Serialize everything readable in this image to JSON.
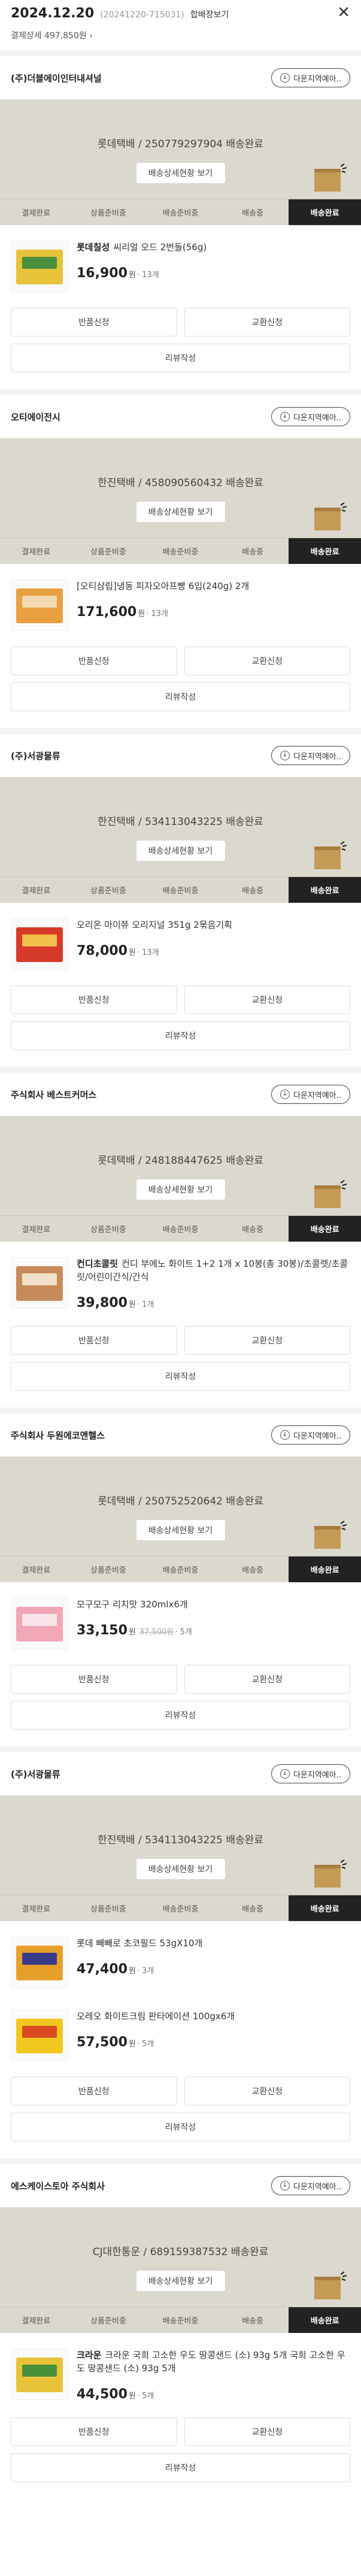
{
  "header": {
    "date": "2024.12.20",
    "order_no": "(20241220-715031)",
    "combine_label": "합배장보기",
    "pay_detail": "결제상세 497,850원 ›",
    "close": "✕"
  },
  "labels": {
    "download": "다운지역예아..",
    "track_button": "배송상세현황 보기",
    "return": "반품신청",
    "exchange": "교환신청",
    "review": "리뷰작성"
  },
  "steps": [
    "결제완료",
    "상품준비중",
    "배송준비중",
    "배송중",
    "배송완료"
  ],
  "sections": [
    {
      "seller": "(주)더블에이인터내셔널",
      "tracking": "롯데택배 / 250779297904 배송완료",
      "items": [
        {
          "brand": "롯데칠성",
          "name": "씨리얼 오드 2번들(56g)",
          "price": "16,900",
          "orig": "",
          "qty": "13개"
        }
      ]
    },
    {
      "seller": "오티에이전시",
      "tracking": "한진택배 / 458090560432 배송완료",
      "items": [
        {
          "brand": "",
          "name": "[오티삼립]냉동 피자오아프빵 6입(240g) 2개",
          "price": "171,600",
          "orig": "",
          "qty": "13개"
        }
      ]
    },
    {
      "seller": "(주)서광물류",
      "tracking": "한진택배 / 534113043225 배송완료",
      "items": [
        {
          "brand": "",
          "name": "오리온 마이쮸 오리지널 351g 2묶음기획",
          "price": "78,000",
          "orig": "",
          "qty": "13개"
        }
      ]
    },
    {
      "seller": "주식회사 베스트커머스",
      "tracking": "롯데택배 / 248188447625 배송완료",
      "items": [
        {
          "brand": "컨디초콜릿",
          "name": "컨디 부에노 화이트 1+2 1개 x 10봉(총 30봉)/초콜렛/초콜릿/어린이간식/간식",
          "price": "39,800",
          "orig": "",
          "qty": "1개"
        }
      ]
    },
    {
      "seller": "주식회사 두원에코앤헬스",
      "tracking": "롯데택배 / 250752520642 배송완료",
      "items": [
        {
          "brand": "",
          "name": "모구모구 리치맛 320mlx6개",
          "price": "33,150",
          "orig": "37,500원",
          "qty": "5개"
        }
      ]
    },
    {
      "seller": "(주)서광물류",
      "tracking": "한진택배 / 534113043225 배송완료",
      "items": [
        {
          "brand": "",
          "name": "롯데 빼빼로 초코필드 53gX10개",
          "price": "47,400",
          "orig": "",
          "qty": "3개"
        },
        {
          "brand": "",
          "name": "오레오 화이트크림 판타에이션 100gx6개",
          "price": "57,500",
          "orig": "",
          "qty": "5개"
        }
      ]
    },
    {
      "seller": "에스케이스토아 주식회사",
      "tracking": "CJ대한통운 / 689159387532 배송완료",
      "items": [
        {
          "brand": "크라운",
          "name": "크라운 국희 고소한 우도 땅콩샌드 (소) 93g 5개 국희 고소한 우도 땅콩샌드 (소) 93g 5개",
          "price": "44,500",
          "orig": "",
          "qty": "5개"
        }
      ]
    }
  ],
  "colors": {
    "delivery_bg": "#dbd8cd",
    "active_step": "#222222",
    "box": "#c49a56"
  }
}
